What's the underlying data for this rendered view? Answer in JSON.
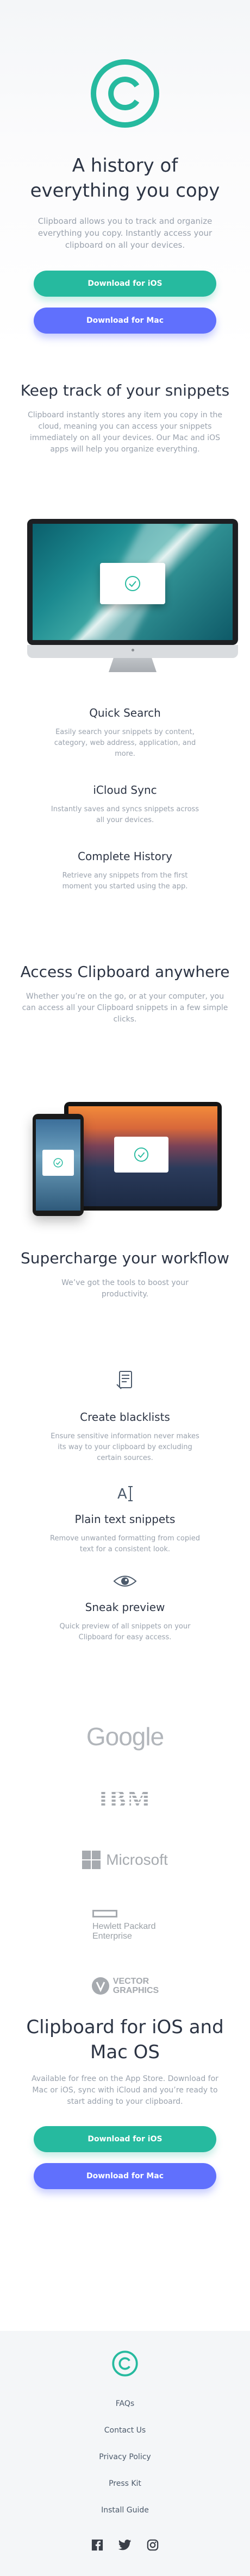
{
  "hero": {
    "title": "A history of everything you copy",
    "text": "Clipboard allows you to track and organize everything you copy. Instantly access your clipboard on all your devices.",
    "ios_button": "Download for iOS",
    "mac_button": "Download for Mac"
  },
  "snippets": {
    "title": "Keep track of your snippets",
    "text": "Clipboard instantly stores any item you copy in the cloud, meaning you can access your snippets immediately on all your devices. Our Mac and iOS apps will help you organize everything.",
    "features": [
      {
        "title": "Quick Search",
        "text": "Easily search your snippets by content, category, web address, application, and more."
      },
      {
        "title": "iCloud Sync",
        "text": "Instantly saves and syncs snippets across all your devices."
      },
      {
        "title": "Complete History",
        "text": "Retrieve any snippets from the first moment you started using the app."
      }
    ]
  },
  "access": {
    "title": "Access Clipboard anywhere",
    "text": "Whether you’re on the go, or at your computer, you can access all your Clipboard snippets in a few simple clicks."
  },
  "supercharge": {
    "title": "Supercharge your workflow",
    "text": "We’ve got the tools to boost your productivity.",
    "features": [
      {
        "icon": "blacklist-icon",
        "title": "Create blacklists",
        "text": "Ensure sensitive information never makes its way to your clipboard by excluding certain sources."
      },
      {
        "icon": "text-cursor-icon",
        "title": "Plain text snippets",
        "text": "Remove unwanted formatting from copied text for a consistent look."
      },
      {
        "icon": "eye-icon",
        "title": "Sneak preview",
        "text": "Quick preview of all snippets on your Clipboard for easy access."
      }
    ]
  },
  "logos": {
    "google": "Google",
    "ibm": "IBM",
    "microsoft": "Microsoft",
    "hp_line1": "Hewlett Packard",
    "hp_line2": "Enterprise",
    "vector_line1": "VECTOR",
    "vector_line2": "GRAPHICS"
  },
  "cta": {
    "title": "Clipboard for iOS and Mac OS",
    "text": "Available for free on the App Store. Download for Mac or iOS, sync with iCloud and you’re ready to start adding to your clipboard.",
    "ios_button": "Download for iOS",
    "mac_button": "Download for Mac"
  },
  "footer": {
    "links": [
      "FAQs",
      "Contact Us",
      "Privacy Policy",
      "Press Kit",
      "Install Guide"
    ],
    "socials": [
      "facebook-icon",
      "twitter-icon",
      "instagram-icon"
    ]
  },
  "colors": {
    "accent_green": "#26ba9f",
    "accent_blue": "#6070fd",
    "heading": "#2c3444",
    "body_text": "#9aa2ad"
  }
}
